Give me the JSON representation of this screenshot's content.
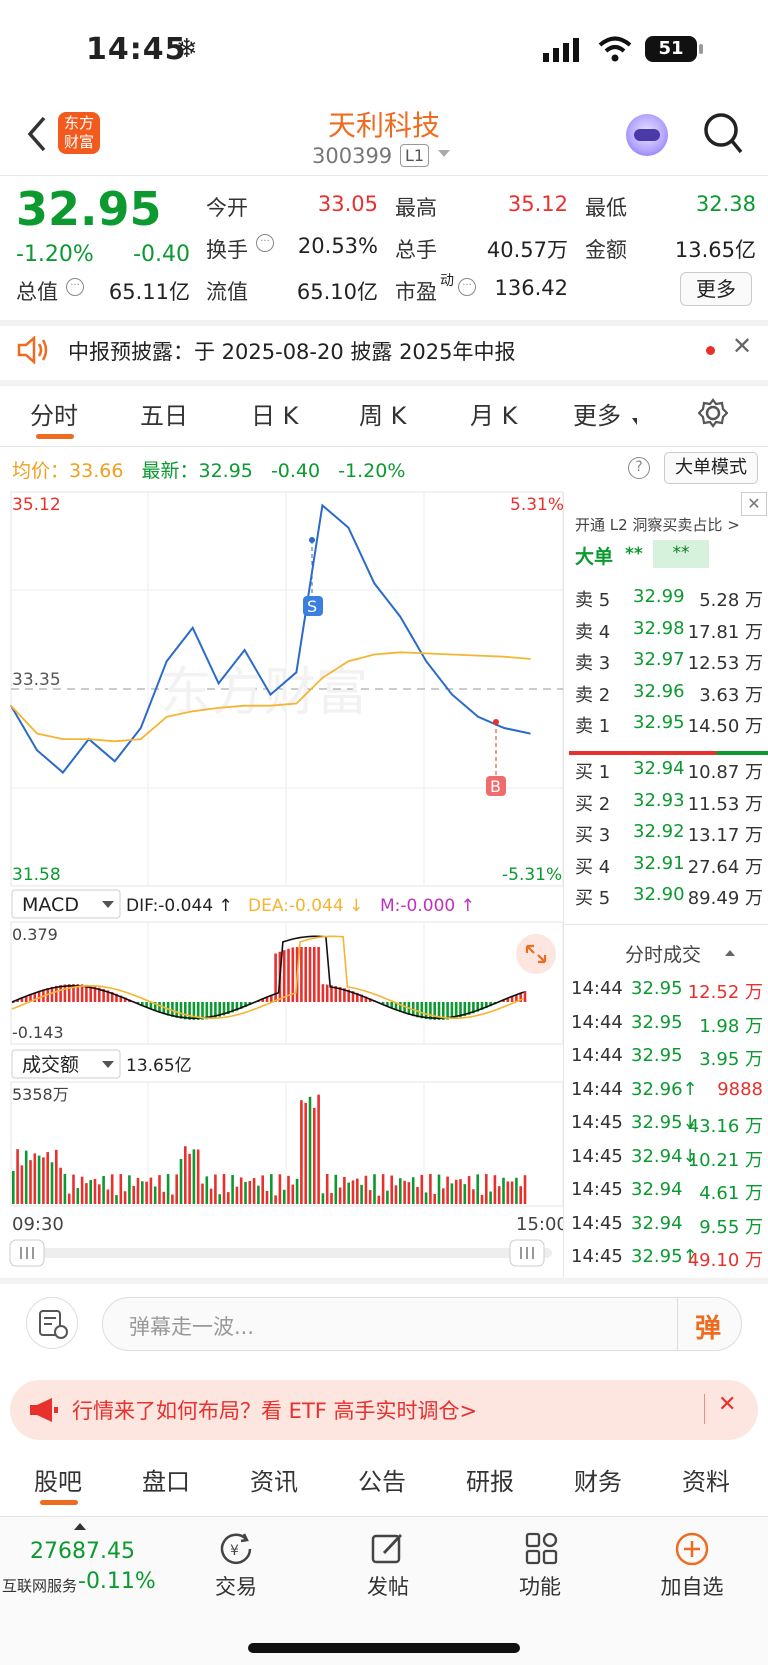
{
  "status": {
    "time": "14:45",
    "battery": "51"
  },
  "header": {
    "stock_name": "天利科技",
    "stock_code": "300399",
    "level": "L1",
    "logo_text": "东方财富"
  },
  "quote": {
    "price": "32.95",
    "change_pct": "-1.20%",
    "change": "-0.40",
    "open_label": "今开",
    "open": "33.05",
    "high_label": "最高",
    "high": "35.12",
    "low_label": "最低",
    "low": "32.38",
    "turnover_label": "换手",
    "turnover": "20.53%",
    "volume_label": "总手",
    "volume": "40.57万",
    "amount_label": "金额",
    "amount": "13.65亿",
    "mktcap_label": "总值",
    "mktcap": "65.11亿",
    "float_label": "流值",
    "float": "65.10亿",
    "pe_label": "市盈",
    "pe_sup": "动",
    "pe": "136.42",
    "more": "更多"
  },
  "notice": {
    "text": "中报预披露：于 2025-08-20 披露 2025年中报"
  },
  "tabs": [
    "分时",
    "五日",
    "日 K",
    "周 K",
    "月 K",
    "更多"
  ],
  "avg_bar": {
    "avg_label": "均价：",
    "avg": "33.66",
    "last_label": "最新：",
    "last": "32.95",
    "chg": "-0.40",
    "pct": "-1.20%",
    "mode_btn": "大单模式"
  },
  "chart": {
    "top_price": "35.12",
    "top_pct": "5.31%",
    "mid_price": "33.35",
    "bottom_price": "31.58",
    "bottom_pct": "-5.31%",
    "macd_select": "MACD",
    "dif": "DIF:-0.044 ↑",
    "dea": "DEA:-0.044 ↓",
    "m": "M:-0.000 ↑",
    "macd_top": "0.379",
    "macd_bottom": "-0.143",
    "vol_select": "成交额",
    "vol_total": "13.65亿",
    "vol_top": "5358万",
    "time_start": "09:30",
    "time_end": "15:00",
    "marker_s": "S",
    "marker_b": "B",
    "colors": {
      "price": "#2a6bc8",
      "avg": "#f5b533",
      "up": "#e8302c",
      "down": "#0c9a30"
    }
  },
  "chart_data": {
    "type": "line",
    "title": "",
    "xlabel": "",
    "ylabel": "",
    "x": [
      "09:30",
      "15:00"
    ],
    "ylim": [
      31.58,
      35.12
    ],
    "series": [
      {
        "values": [
          33.2,
          32.8,
          32.6,
          32.9,
          32.7,
          33.0,
          33.6,
          33.9,
          33.4,
          33.7,
          33.3,
          33.5,
          35.0,
          34.8,
          34.3,
          34.0,
          33.6,
          33.3,
          33.1,
          33.0,
          32.95
        ]
      },
      {
        "values": [
          33.2,
          32.95,
          32.9,
          32.9,
          32.88,
          32.9,
          33.1,
          33.15,
          33.18,
          33.2,
          33.2,
          33.22,
          33.45,
          33.6,
          33.66,
          33.68,
          33.67,
          33.66,
          33.65,
          33.64,
          33.62
        ]
      }
    ]
  },
  "orderbook": {
    "header": "开通 L2 洞察买卖占比 >",
    "big_label": "大单",
    "big_val1": "**",
    "big_val2": "**",
    "asks": [
      {
        "label": "卖 5",
        "price": "32.99",
        "vol": "5.28 万"
      },
      {
        "label": "卖 4",
        "price": "32.98",
        "vol": "17.81 万"
      },
      {
        "label": "卖 3",
        "price": "32.97",
        "vol": "12.53 万"
      },
      {
        "label": "卖 2",
        "price": "32.96",
        "vol": "3.63 万"
      },
      {
        "label": "卖 1",
        "price": "32.95",
        "vol": "14.50 万"
      }
    ],
    "bids": [
      {
        "label": "买 1",
        "price": "32.94",
        "vol": "10.87 万"
      },
      {
        "label": "买 2",
        "price": "32.93",
        "vol": "11.53 万"
      },
      {
        "label": "买 3",
        "price": "32.92",
        "vol": "13.17 万"
      },
      {
        "label": "买 4",
        "price": "32.91",
        "vol": "27.64 万"
      },
      {
        "label": "买 5",
        "price": "32.90",
        "vol": "89.49 万"
      }
    ],
    "trades_title": "分时成交",
    "trades": [
      {
        "t": "14:44",
        "p": "32.95",
        "v": "12.52 万",
        "dir": "up"
      },
      {
        "t": "14:44",
        "p": "32.95",
        "v": "1.98 万",
        "dir": "down"
      },
      {
        "t": "14:44",
        "p": "32.95",
        "v": "3.95 万",
        "dir": "down"
      },
      {
        "t": "14:44",
        "p": "32.96↑",
        "v": "9888",
        "dir": "up"
      },
      {
        "t": "14:45",
        "p": "32.95↓",
        "v": "43.16 万",
        "dir": "down"
      },
      {
        "t": "14:45",
        "p": "32.94↓",
        "v": "10.21 万",
        "dir": "down"
      },
      {
        "t": "14:45",
        "p": "32.94",
        "v": "4.61 万",
        "dir": "down"
      },
      {
        "t": "14:45",
        "p": "32.94",
        "v": "9.55 万",
        "dir": "down"
      },
      {
        "t": "14:45",
        "p": "32.95↑",
        "v": "49.10 万",
        "dir": "up"
      }
    ]
  },
  "danmu": {
    "placeholder": "弹幕走一波...",
    "btn": "弹"
  },
  "promo": {
    "text": "行情来了如何布局？看 ETF 高手实时调仓>"
  },
  "subtabs": [
    "股吧",
    "盘口",
    "资讯",
    "公告",
    "研报",
    "财务",
    "资料"
  ],
  "bottom": {
    "index_value": "27687.45",
    "index_name": "互联网服务",
    "index_pct": "-0.11%",
    "trade": "交易",
    "post": "发帖",
    "func": "功能",
    "add": "加自选"
  }
}
